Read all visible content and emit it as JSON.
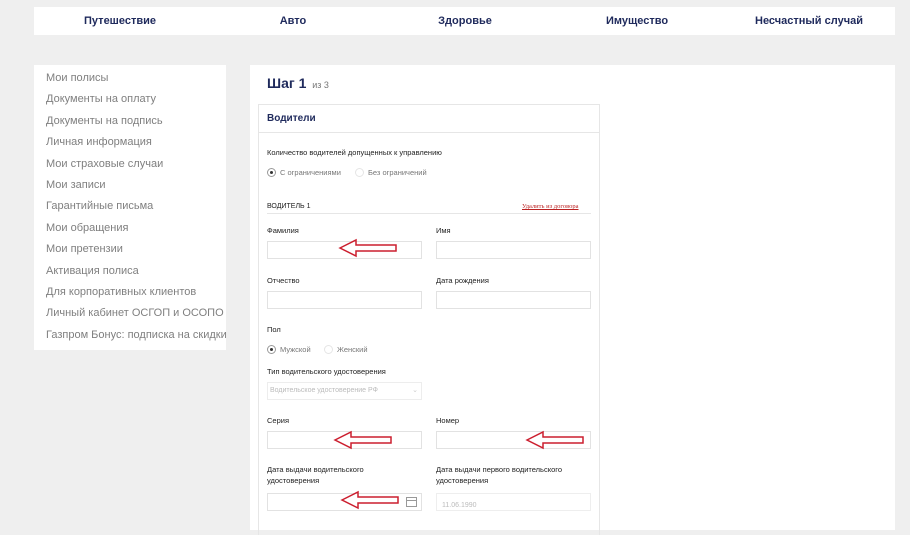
{
  "topnav": {
    "items": [
      "Путешествие",
      "Авто",
      "Здоровье",
      "Имущество",
      "Несчастный случай"
    ]
  },
  "sidebar": {
    "items": [
      "Мои полисы",
      "Документы на оплату",
      "Документы на подпись",
      "Личная информация",
      "Мои страховые случаи",
      "Мои записи",
      "Гарантийные письма",
      "Мои обращения",
      "Мои претензии",
      "Активация полиса",
      "Для корпоративных клиентов",
      "Личный кабинет ОСГОП и ОСОПО",
      "Газпром Бонус: подписка на скидки"
    ]
  },
  "step": {
    "title": "Шаг 1",
    "of": "из 3"
  },
  "card": {
    "title": "Водители"
  },
  "drivers_count": {
    "label": "Количество водителей допущенных к управлению",
    "options": [
      {
        "label": "С ограничениями",
        "selected": true
      },
      {
        "label": "Без ограничений",
        "selected": false
      }
    ]
  },
  "driver": {
    "heading": "ВОДИТЕЛЬ 1",
    "remove_label": "Удалить из договора",
    "fields": {
      "last_name": {
        "label": "Фамилия",
        "value": ""
      },
      "first_name": {
        "label": "Имя",
        "value": ""
      },
      "patronymic": {
        "label": "Отчество",
        "value": ""
      },
      "birth_date": {
        "label": "Дата рождения",
        "value": ""
      },
      "series": {
        "label": "Серия",
        "value": ""
      },
      "number": {
        "label": "Номер",
        "value": ""
      },
      "issue_date": {
        "label": "Дата выдачи водительского удостоверения",
        "value": ""
      },
      "first_issue_date": {
        "label": "Дата выдачи первого водительского удостоверения",
        "placeholder": "11.06.1990"
      }
    },
    "gender": {
      "label": "Пол",
      "options": [
        {
          "label": "Мужской",
          "selected": true
        },
        {
          "label": "Женский",
          "selected": false
        }
      ]
    },
    "license_type": {
      "label": "Тип водительского удостоверения",
      "selected": "Водительское удостоверение РФ"
    }
  },
  "colors": {
    "accent": "#1f2a5c",
    "arrow": "#cc1f2f",
    "link": "#b22222"
  },
  "icons": {
    "calendar": "calendar-icon",
    "chevron": "chevron-down-icon",
    "arrow": "arrow-left-icon"
  }
}
